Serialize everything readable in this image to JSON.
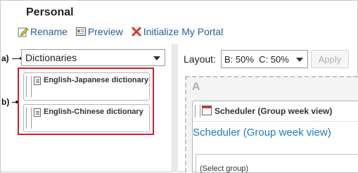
{
  "title": "Personal",
  "toolbar": {
    "rename": "Rename",
    "preview": "Preview",
    "initialize": "Initialize My Portal"
  },
  "palette": {
    "category_select": "Dictionaries",
    "items": [
      {
        "label": "English-Japanese dictionary"
      },
      {
        "label": "English-Chinese dictionary"
      }
    ]
  },
  "callouts": {
    "a": "a)",
    "b": "b)"
  },
  "layout": {
    "label": "Layout:",
    "value": "B: 50%  C: 50%",
    "apply": "Apply"
  },
  "area": {
    "letter": "A",
    "portlet_title": "Scheduler (Group week view)",
    "portlet_link": "Scheduler (Group week view)",
    "group_select": "(Select group)"
  },
  "colors": {
    "link": "#1f5e9c",
    "highlight": "#d0202a",
    "initialize_icon": "#d23a1e"
  }
}
